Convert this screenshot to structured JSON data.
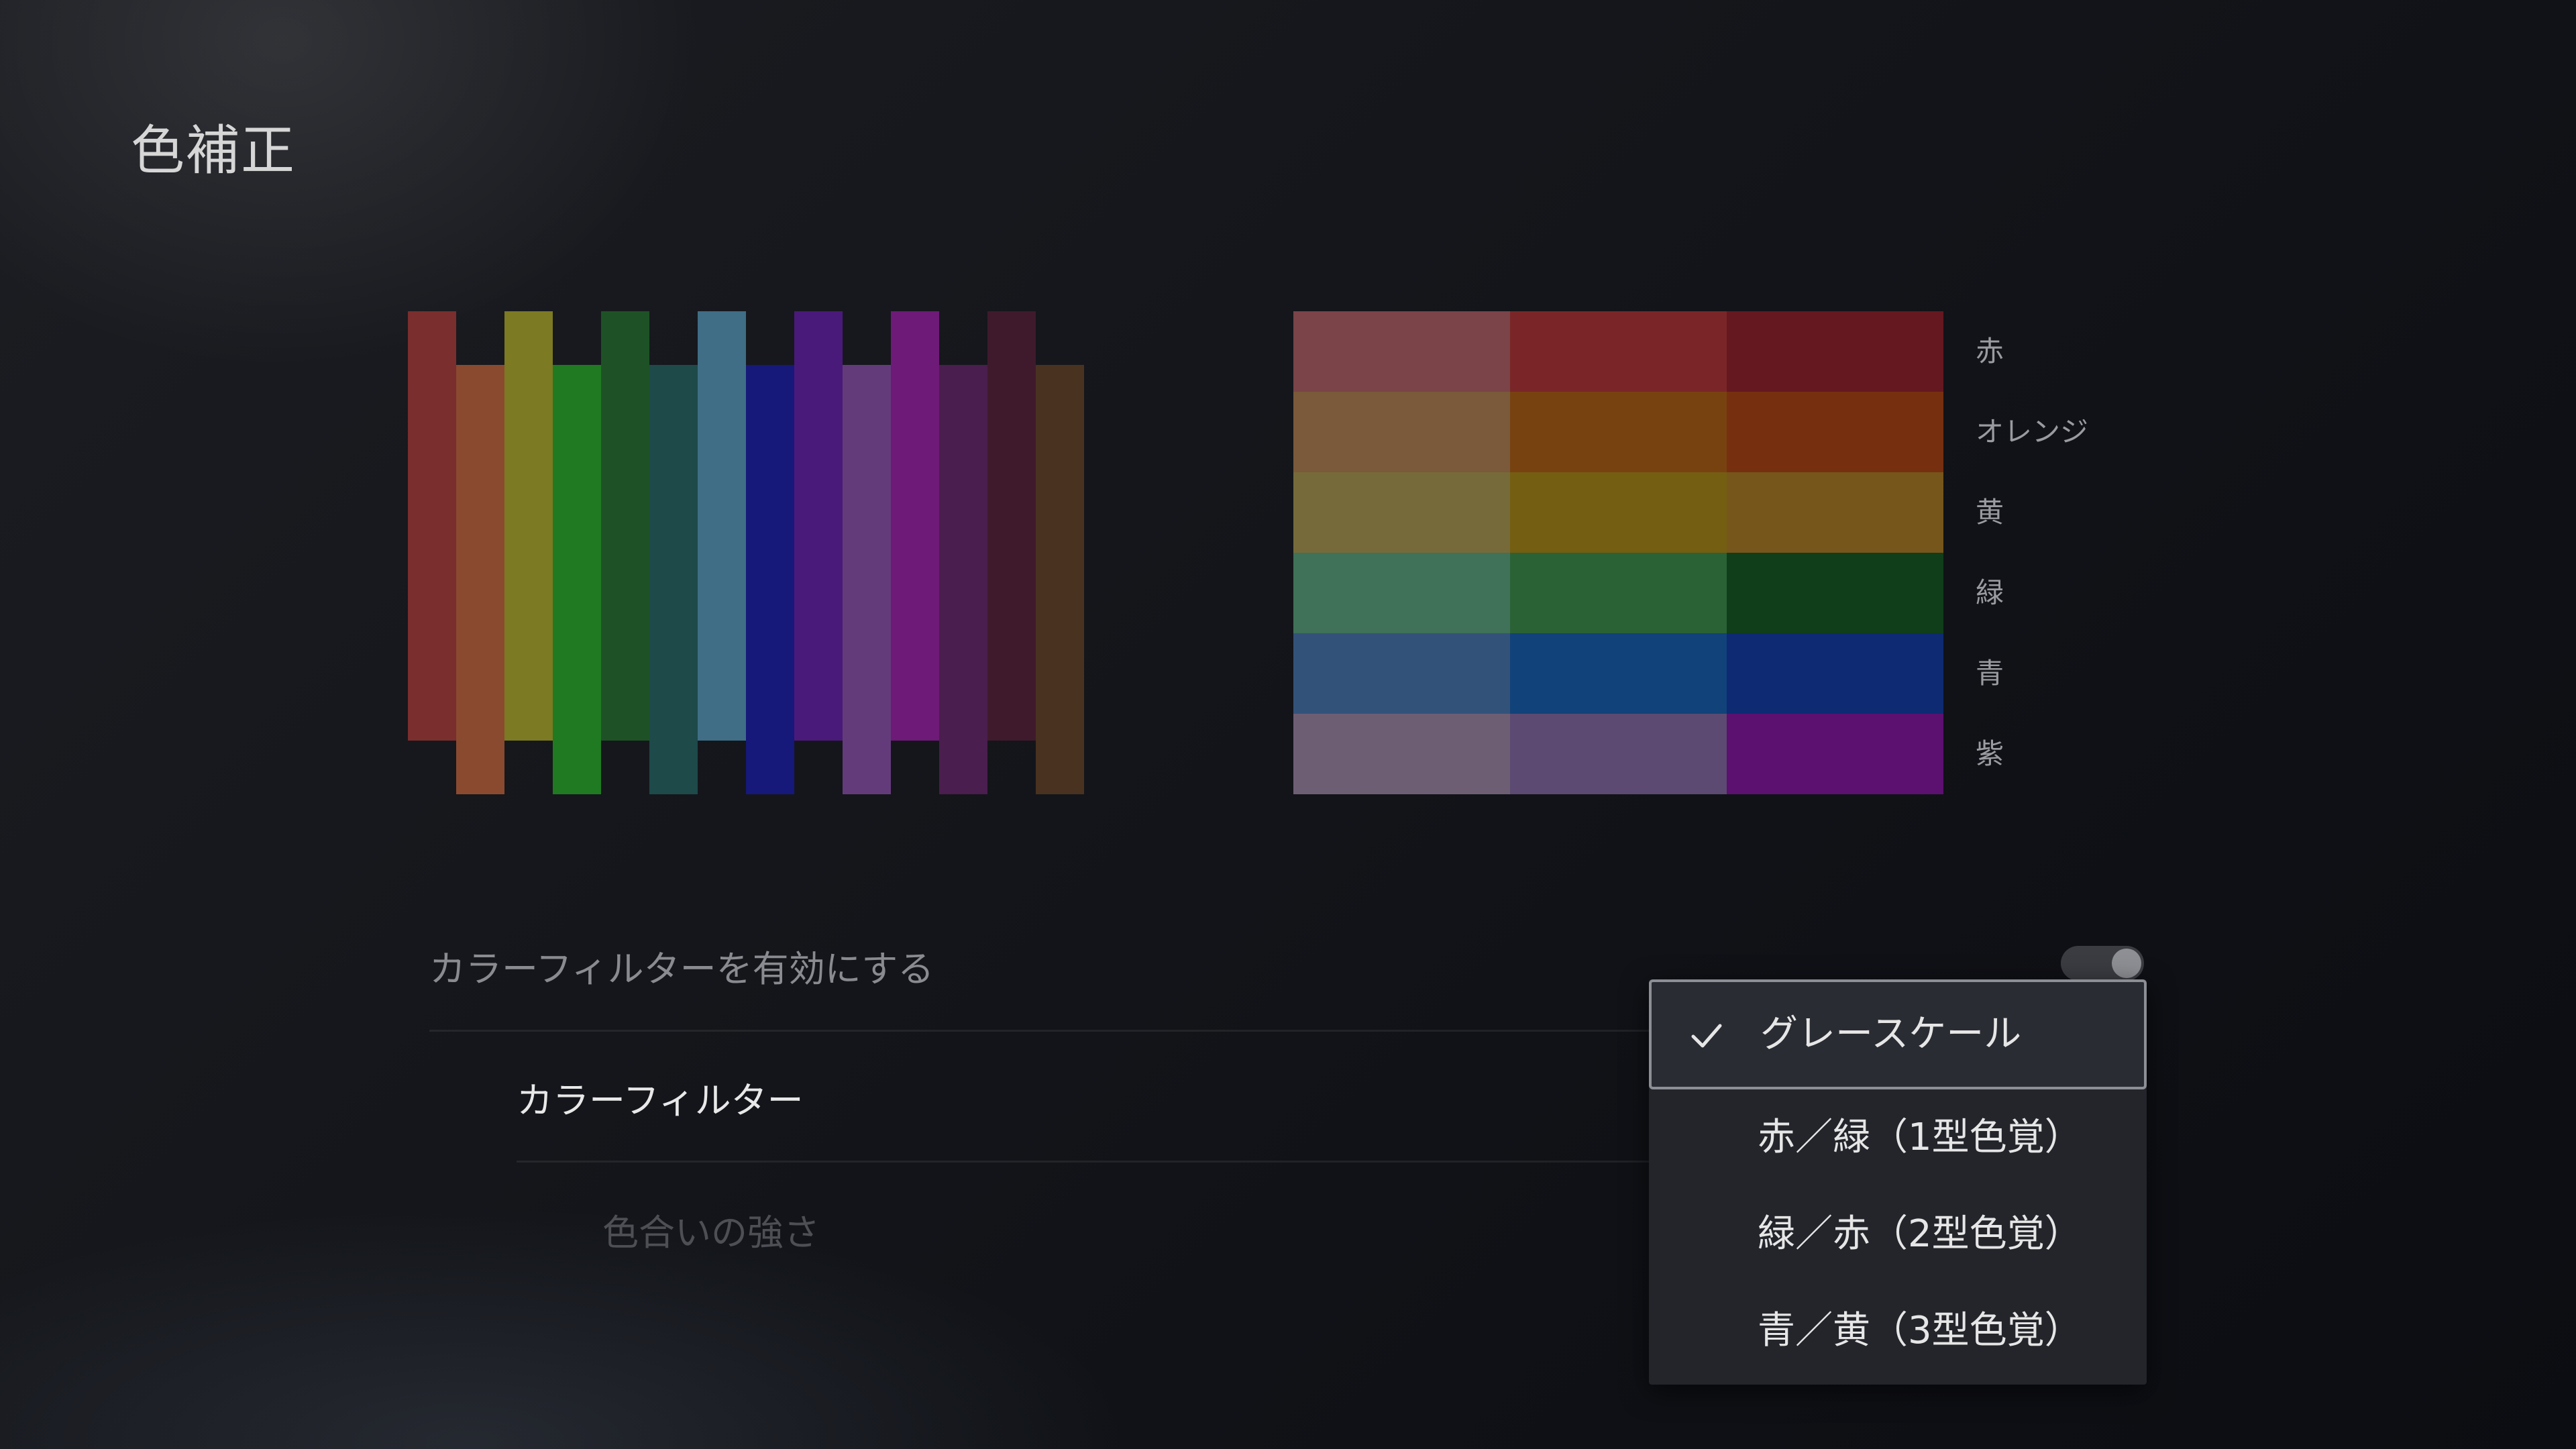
{
  "page": {
    "title": "色補正"
  },
  "bars": [
    {
      "color": "#7a2e2e",
      "pos": "up"
    },
    {
      "color": "#8a4a30",
      "pos": "down"
    },
    {
      "color": "#7c7a22",
      "pos": "up"
    },
    {
      "color": "#1f7a22",
      "pos": "down"
    },
    {
      "color": "#1e5226",
      "pos": "up"
    },
    {
      "color": "#1e4a4a",
      "pos": "down"
    },
    {
      "color": "#3f6e86",
      "pos": "up"
    },
    {
      "color": "#16187a",
      "pos": "down"
    },
    {
      "color": "#4a1a7a",
      "pos": "up"
    },
    {
      "color": "#633b7a",
      "pos": "down"
    },
    {
      "color": "#6e1a78",
      "pos": "up"
    },
    {
      "color": "#4a1e4e",
      "pos": "down"
    },
    {
      "color": "#3f1a2c",
      "pos": "up"
    },
    {
      "color": "#4a3220",
      "pos": "down"
    }
  ],
  "grid": {
    "rows": [
      {
        "label": "赤",
        "colors": [
          "#7a4448",
          "#7a2628",
          "#661820"
        ]
      },
      {
        "label": "オレンジ",
        "colors": [
          "#7a5a3a",
          "#784210",
          "#763010"
        ]
      },
      {
        "label": "黄",
        "colors": [
          "#766a3a",
          "#745e12",
          "#76561a"
        ]
      },
      {
        "label": "緑",
        "colors": [
          "#3f7258",
          "#2a6236",
          "#103e1a"
        ]
      },
      {
        "label": "青",
        "colors": [
          "#33527a",
          "#12427a",
          "#0e2a72"
        ]
      },
      {
        "label": "紫",
        "colors": [
          "#6e5e74",
          "#5c4a72",
          "#5c1070"
        ]
      }
    ]
  },
  "settings": {
    "enable_label": "カラーフィルターを有効にする",
    "enable_toggle_on": true,
    "filter_label": "カラーフィルター",
    "intensity_label": "色合いの強さ"
  },
  "dropdown": {
    "options": [
      {
        "label": "グレースケール",
        "selected": true
      },
      {
        "label": "赤／緑（1型色覚）",
        "selected": false
      },
      {
        "label": "緑／赤（2型色覚）",
        "selected": false
      },
      {
        "label": "青／黄（3型色覚）",
        "selected": false
      }
    ]
  }
}
